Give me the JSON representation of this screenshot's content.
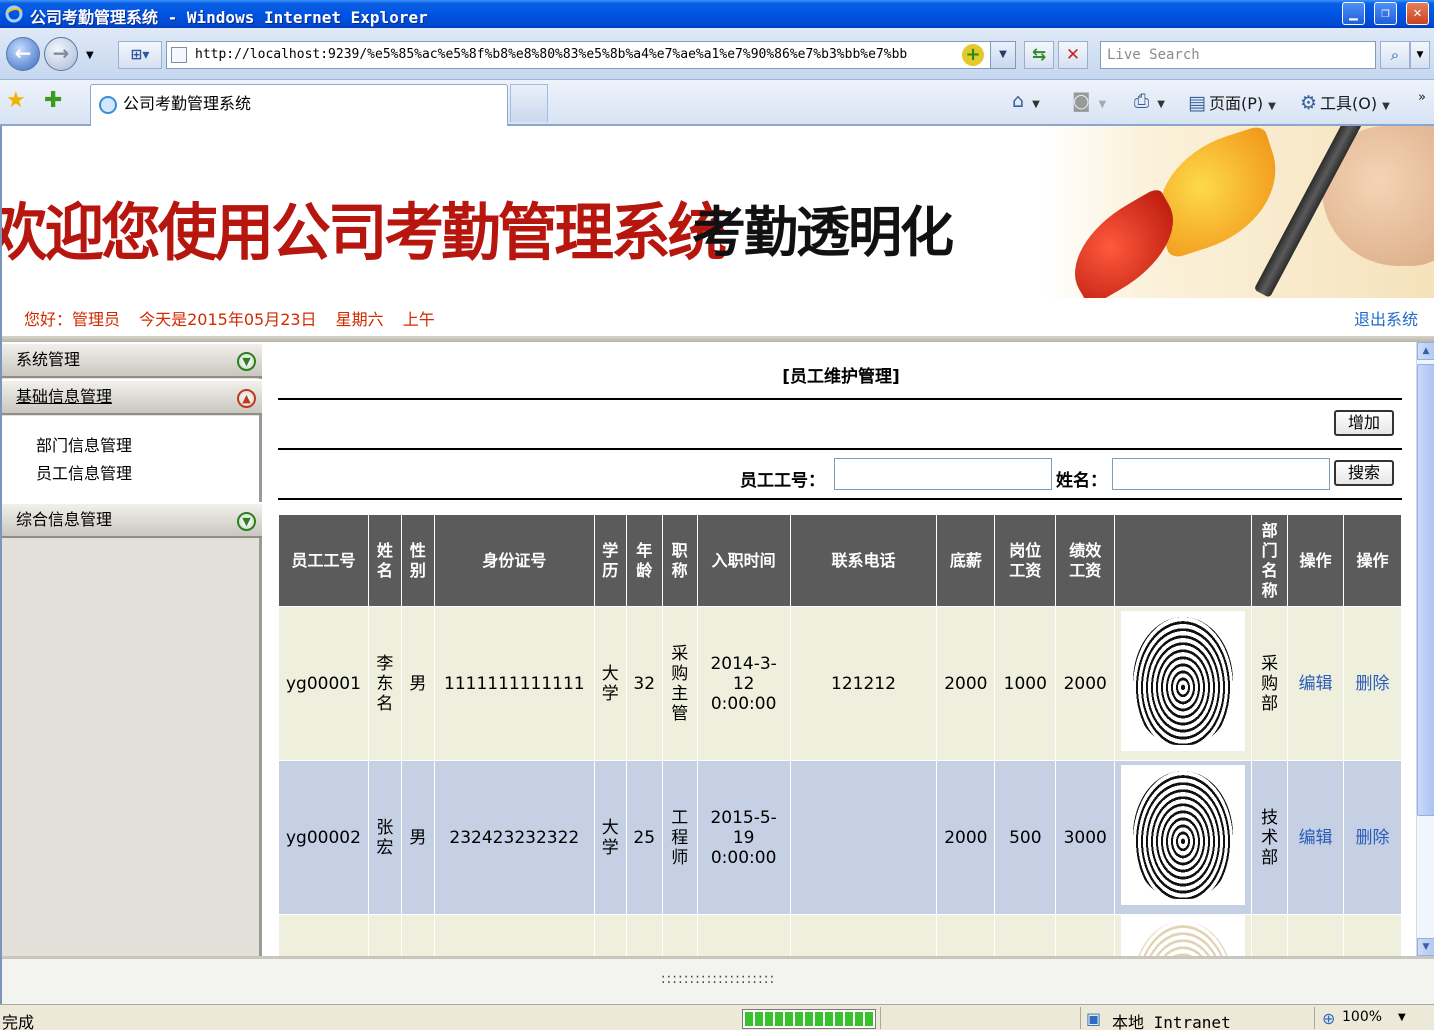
{
  "window": {
    "title": "公司考勤管理系统 - Windows Internet Explorer"
  },
  "address": {
    "url": "http://localhost:9239/%e5%85%ac%e5%8f%b8%e8%80%83%e5%8b%a4%e7%ae%a1%e7%90%86%e7%b3%bb%e7%bb",
    "search_placeholder": "Live Search"
  },
  "tabs": [
    {
      "label": "公司考勤管理系统"
    }
  ],
  "commands": {
    "page": "页面(P)",
    "tools": "工具(O)"
  },
  "banner": {
    "title": "欢迎您使用公司考勤管理系统",
    "slogan": "考勤透明化"
  },
  "info": {
    "greeting": "您好：管理员",
    "date": "今天是2015年05月23日",
    "weekday": "星期六",
    "period": "上午",
    "logout": "退出系统"
  },
  "sidebar": {
    "groups": [
      {
        "label": "系统管理"
      },
      {
        "label": "基础信息管理"
      },
      {
        "label": "综合信息管理"
      }
    ],
    "sub_items": [
      {
        "label": "部门信息管理"
      },
      {
        "label": "员工信息管理"
      }
    ]
  },
  "main": {
    "section_title": "[员工维护管理]",
    "add_button": "增加",
    "search": {
      "id_label": "员工工号：",
      "name_label": "姓名：",
      "button": "搜索"
    },
    "columns": [
      "员工工号",
      "姓名",
      "性别",
      "身份证号",
      "学历",
      "年龄",
      "职称",
      "入职时间",
      "联系电话",
      "底薪",
      "岗位工资",
      "绩效工资",
      "",
      "部门名称",
      "操作",
      "操作"
    ],
    "rows": [
      {
        "id": "yg00001",
        "name": "李东名",
        "gender": "男",
        "idcard": "1111111111111",
        "edu": "大学",
        "age": "32",
        "title": "采购主管",
        "hired": "2014-3-12 0:00:00",
        "phone": "121212",
        "base": "2000",
        "post": "1000",
        "perf": "2000",
        "dept": "采购部",
        "edit": "编辑",
        "delete": "删除"
      },
      {
        "id": "yg00002",
        "name": "张宏",
        "gender": "男",
        "idcard": "232423232322",
        "edu": "大学",
        "age": "25",
        "title": "工程师",
        "hired": "2015-5-19 0:00:00",
        "phone": "",
        "base": "2000",
        "post": "500",
        "perf": "3000",
        "dept": "技术部",
        "edit": "编辑",
        "delete": "删除"
      }
    ]
  },
  "footer": {
    "dots": "::::::::::::::::::::"
  },
  "status": {
    "text": "完成",
    "progress": 1.0,
    "zone": "本地 Intranet",
    "zoom": "100%"
  }
}
